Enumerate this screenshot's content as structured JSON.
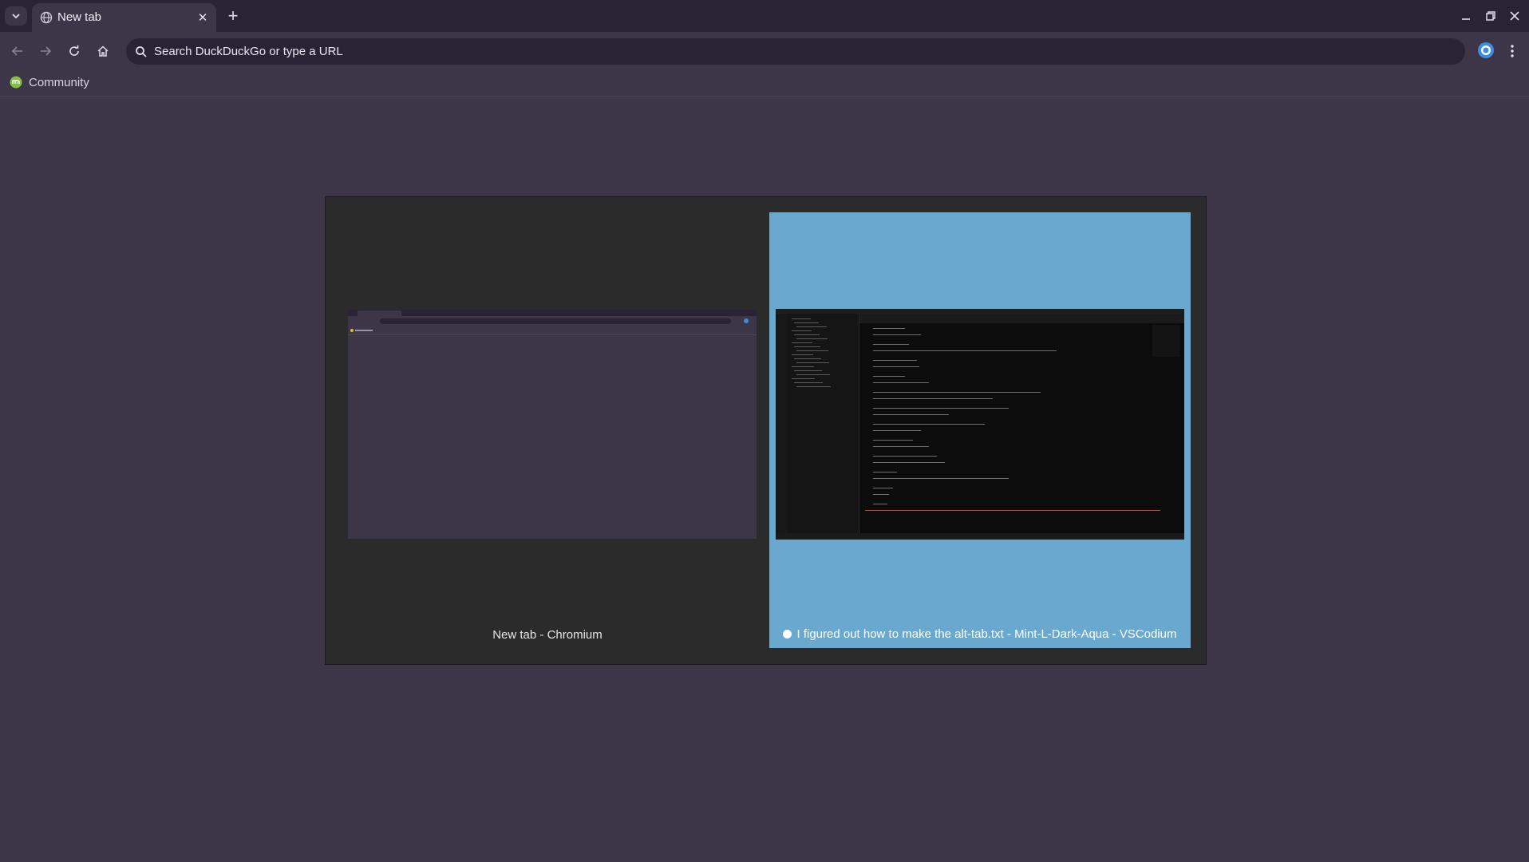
{
  "tab": {
    "title": "New tab",
    "close_icon": "close-icon",
    "favicon": "globe-icon"
  },
  "toolbar": {
    "omnibox_placeholder": "Search DuckDuckGo or type a URL"
  },
  "bookmarks": [
    {
      "label": "Community"
    }
  ],
  "switcher": {
    "windows": [
      {
        "caption": "New tab - Chromium"
      },
      {
        "caption": "I figured out how to make the alt-tab.txt - Mint-L-Dark-Aqua - VSCodium",
        "selected": true
      }
    ]
  },
  "colors": {
    "page_bg": "#3d3548",
    "tabstrip_bg": "#2a2336",
    "switcher_bg": "#2b2b2b",
    "selection_bg": "#6aa9cf"
  }
}
